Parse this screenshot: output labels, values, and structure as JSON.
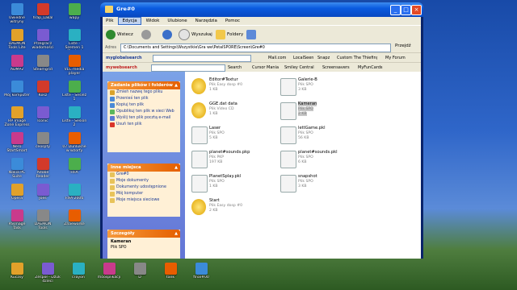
{
  "window": {
    "title": "Gre#0",
    "menu": [
      "Plik",
      "Edycja",
      "Widok",
      "Ulubione",
      "Narzędzia",
      "Pomoc"
    ],
    "toolbar": {
      "back": "Wstecz",
      "search": "Wyszukaj",
      "folders": "Foldery"
    },
    "address": {
      "label": "Adres",
      "path": "C:\\Documents and Settings\\Wszystkie\\Gra we\\PetalSPORE\\Screen\\Gre#0",
      "go": "Przejdź"
    },
    "webbar": {
      "brand": "myglobalsearch",
      "items": [
        "Mail.com",
        "LocalSeen",
        "Snapz",
        "Custom The Thiefing",
        "My Forum"
      ]
    },
    "searchbar": {
      "brand": "mywebsearch",
      "search": "Search",
      "items": [
        "Cursor Mania",
        "Smiley Central",
        "Screensavers",
        "MyFunCards"
      ]
    },
    "window_buttons": {
      "min": "_",
      "max": "□",
      "close": "×"
    }
  },
  "tasks": {
    "title": "Zadania plików i folderów",
    "items": [
      "Zmień nazwę tego pliku",
      "Przenieś ten plik",
      "Kopiuj ten plik",
      "Opublikuj ten plik w sieci Web",
      "Wyślij ten plik pocztą e-mail",
      "Usuń ten plik"
    ]
  },
  "places": {
    "title": "Inne miejsca",
    "items": [
      "Gre#0",
      "Moje dokumenty",
      "Dokumenty udostępnione",
      "Mój komputer",
      "Moje miejsca sieciowe"
    ]
  },
  "details": {
    "title": "Szczegóły",
    "name": "Kameran",
    "type": "Plik SPO"
  },
  "files": [
    {
      "name": "Editor#Textur",
      "type": "Plik Easy dosp #0",
      "size": "1 KB"
    },
    {
      "name": "Galerie-B",
      "type": "Plik SPO",
      "size": "3 KB"
    },
    {
      "name": "GGE.dat data",
      "type": "Plik Video CD",
      "size": "1 KB"
    },
    {
      "name": "Kameran",
      "type": "Plik SPO",
      "size": "2 KB"
    },
    {
      "name": "Laser",
      "type": "Plik SPO",
      "size": "5 KB"
    },
    {
      "name": "lettGame.pkl",
      "type": "Plik SPO",
      "size": "56 KB"
    },
    {
      "name": "planet#sounds.pkp",
      "type": "Plik PKP",
      "size": "197 KB"
    },
    {
      "name": "planet#sounds.pkl",
      "type": "Plik SPO",
      "size": "6 KB"
    },
    {
      "name": "PlanetSplay.pkl",
      "type": "Plik SPO",
      "size": "1 KB"
    },
    {
      "name": "snapshot",
      "type": "Plik SPO",
      "size": "3 KB"
    },
    {
      "name": "Start",
      "type": "Plik Easy dosp #0",
      "size": "2 KB"
    }
  ],
  "desktop": [
    {
      "label": "Uwiedne witryny"
    },
    {
      "label": "hrap_Lakal"
    },
    {
      "label": "wapy"
    },
    {
      "label": "DAEMON Tools Lite"
    },
    {
      "label": "Przegracz wiadomości"
    },
    {
      "label": "Liste - Szemen 1 (Engine)"
    },
    {
      "label": "ADMP2"
    },
    {
      "label": "Steamgrid"
    },
    {
      "label": "VLC media player"
    },
    {
      "label": "Mój komputer"
    },
    {
      "label": "Kosz"
    },
    {
      "label": "Liste - Sesiez 1"
    },
    {
      "label": "HP Image Zone Express"
    },
    {
      "label": "Iconic"
    },
    {
      "label": "Liste - Sesion 2"
    },
    {
      "label": "Nero StartSmart"
    },
    {
      "label": "ceospty"
    },
    {
      "label": "07 Dunlukne w wzorfy"
    },
    {
      "label": "Nokia PC Suite"
    },
    {
      "label": "Adobe Reader"
    },
    {
      "label": "FIFA"
    },
    {
      "label": "Opera"
    },
    {
      "label": "Joes"
    },
    {
      "label": "FIFA 2006"
    },
    {
      "label": "Pasmage Task"
    },
    {
      "label": "DAEMON Tools"
    },
    {
      "label": "Znaeworke"
    }
  ],
  "desktop_bottom": [
    {
      "label": "Kuczsy"
    },
    {
      "label": "Zespół - Dzuk dzieci"
    },
    {
      "label": "crayon"
    },
    {
      "label": "moosplikacji"
    },
    {
      "label": "D"
    },
    {
      "label": "tank"
    },
    {
      "label": "final#00"
    }
  ]
}
